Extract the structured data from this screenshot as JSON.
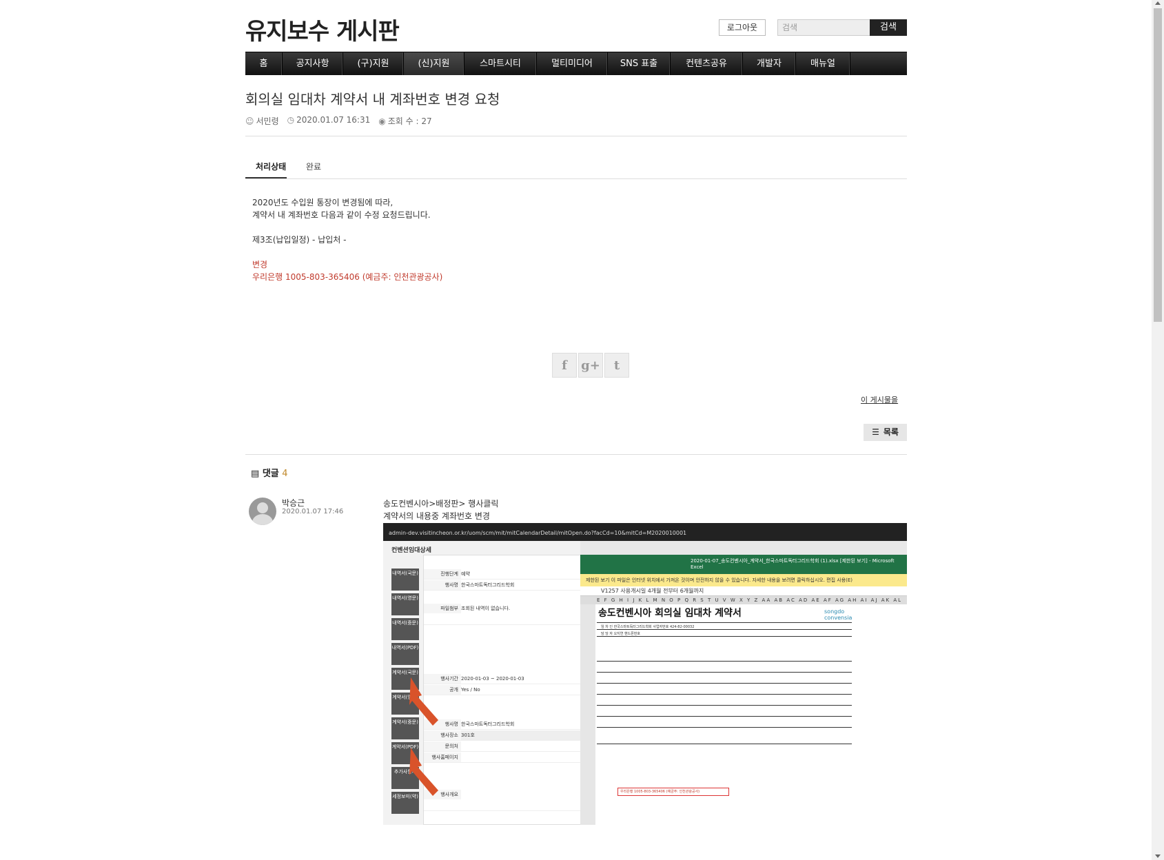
{
  "site": {
    "title": "유지보수 게시판"
  },
  "header": {
    "logout_label": "로그아웃",
    "search_placeholder": "검색",
    "search_button": "검색"
  },
  "nav": {
    "items": [
      {
        "label": "홈"
      },
      {
        "label": "공지사항"
      },
      {
        "label": "(구)지원"
      },
      {
        "label": "(신)지원"
      },
      {
        "label": "스마트시티"
      },
      {
        "label": "멀티미디어"
      },
      {
        "label": "SNS 표출"
      },
      {
        "label": "컨텐츠공유"
      },
      {
        "label": "개발자"
      },
      {
        "label": "매뉴얼"
      }
    ]
  },
  "post": {
    "title": "회의실 임대차 계약서 내 계좌번호 변경 요청",
    "author": "서민령",
    "datetime": "2020.01.07 16:31",
    "views_label": "조회 수 : 27",
    "status_label": "처리상태",
    "status_value": "완료",
    "body": {
      "line1": "2020년도 수입원 통장이 변경됨에 따라,",
      "line2": "계약서 내 계좌번호 다음과 같이 수정 요청드립니다.",
      "line3": "제3조(납입일정) - 납입처 -",
      "line4": "변경",
      "line5": "우리은행 1005-803-365406 (예금주: 인천관광공사)"
    },
    "report_link": "이 게시물을",
    "list_button": "목록"
  },
  "share": {
    "facebook": "f",
    "google": "g+",
    "twitter": "t"
  },
  "comments": {
    "label": "댓글",
    "count": "4",
    "items": [
      {
        "author": "박승근",
        "date": "2020.01.07 17:46",
        "text1": "송도컨벤시아>배정판> 행사클릭",
        "text2": "계약서의 내용중 계좌번호 변경"
      }
    ]
  },
  "screenshot": {
    "url": "admin-dev.visitincheon.or.kr/uom/scm/mit/mitCalendarDetail/mitOpen.do?facCd=10&mitCd=M2020010001",
    "pane_title": "컨벤션임대상세",
    "side_buttons": [
      "내역서(국문)",
      "내역서(영문)",
      "내역서(중문)",
      "내역서(PDF)",
      "계약서(국문)",
      "계약서(영문)",
      "계약서(중문)",
      "계약서(PDF)",
      "추가사항서",
      "세정보미(약)"
    ],
    "rows": [
      {
        "k": "진행단계",
        "v": "예약"
      },
      {
        "k": "행사명",
        "v": "한국스마트독터그리드학회"
      },
      {
        "k": "파일첨부",
        "v": "조회된 내역이 없습니다."
      },
      {
        "k": "행사기간",
        "v": "2020-01-03 ~ 2020-01-03"
      },
      {
        "k": "공개",
        "v": "Yes / No"
      },
      {
        "k": "행사명",
        "v": "한국스마트독터그리드학회"
      },
      {
        "k": "행사장소",
        "v": "301호"
      },
      {
        "k": "문의처",
        "v": ""
      },
      {
        "k": "행사홈페이지",
        "v": ""
      },
      {
        "k": "행사개요",
        "v": ""
      }
    ],
    "excel_title": "2020-01-07_송도컨벤시아_계약서_한국스마트독터그리드학회 (1).xlsx [제한된 보기] - Microsoft Excel",
    "excel_warn": "제한된 보기   이 파일은 인터넷 위치에서 가져온 것이며 안전하지 않을 수 있습니다. 자세한 내용을 보려면 클릭하십시오.   편집 사용(E)",
    "formula": "V1257        사용개시일 4개월 전부터 6개월까지",
    "cols": "E F G H I J K L M N O P Q R S T U V W X Y Z AA AB AC AD AE AF AG AH AI AJ AK AL",
    "doc_title": "송도컨벤시아 회의실 임대차 계약서",
    "doc_logo": "songdo convensia",
    "doc_lines": [
      "임 차 인  한국스마트독터그리드학회    사업자번호 424-82-00032",
      "담 당 자  오지연    핸드폰번호",
      "우리은행 1005-803-365406 (예금주: 인천관광공사)"
    ]
  }
}
